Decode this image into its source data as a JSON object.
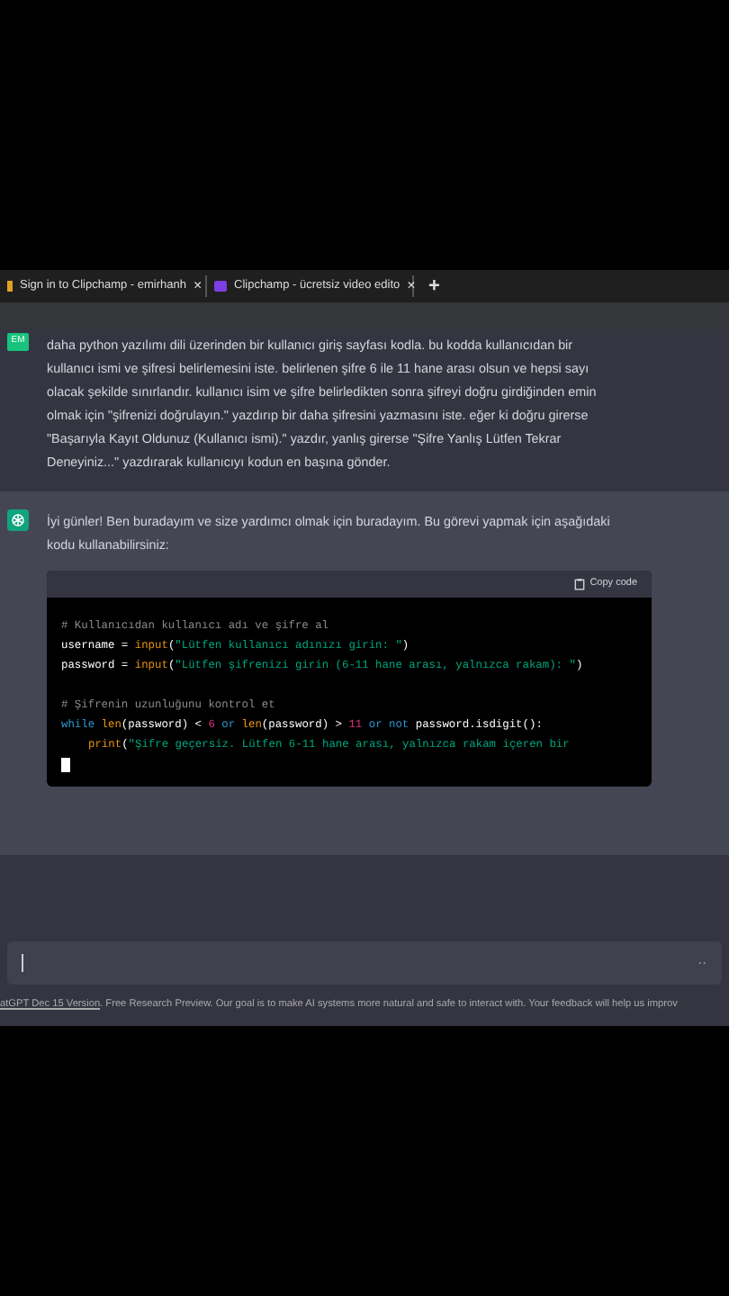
{
  "browser_tabs": [
    {
      "title": "Sign in to Clipchamp - emirhanh",
      "close": "×"
    },
    {
      "title": "Clipchamp - ücretsiz video edito",
      "close": "×"
    }
  ],
  "new_tab": "+",
  "messages": [
    {
      "kind": "user",
      "avatar": "EM",
      "paragraphs": [
        "daha python yazılımı dili üzerinden bir kullanıcı giriş sayfası kodla. bu kodda kullanıcıdan bir kullanıcı ismi ve şifresi belirlemesini iste. belirlenen şifre 6 ile 11 hane arası olsun ve hepsi sayı olacak şekilde sınırlandır. kullanıcı isim ve şifre belirledikten sonra şifreyi doğru girdiğinden emin olmak için \"şifrenizi doğrulayın.\" yazdırıp bir daha şifresini yazmasını iste. eğer ki doğru girerse \"Başarıyla Kayıt Oldunuz (Kullanıcı ismi).\" yazdır, yanlış girerse \"Şifre Yanlış Lütfen Tekrar Deneyiniz...\" yazdırarak kullanıcıyı kodun en başına gönder."
      ]
    },
    {
      "kind": "assistant",
      "paragraphs": [
        "İyi günler! Ben buradayım ve size yardımcı olmak için buradayım. Bu görevi yapmak için aşağıdaki kodu kullanabilirsiniz:"
      ],
      "code": {
        "copy_label": "Copy code",
        "lines": [
          [
            {
              "kind": "comment",
              "text": "# Kullanıcıdan kullanıcı adı ve şifre al"
            }
          ],
          [
            {
              "kind": "plain",
              "text": "username = "
            },
            {
              "kind": "func",
              "text": "input"
            },
            {
              "kind": "plain",
              "text": "("
            },
            {
              "kind": "string",
              "text": "\"Lütfen kullanıcı adınızı girin: \""
            },
            {
              "kind": "plain",
              "text": ")"
            }
          ],
          [
            {
              "kind": "plain",
              "text": "password = "
            },
            {
              "kind": "func",
              "text": "input"
            },
            {
              "kind": "plain",
              "text": "("
            },
            {
              "kind": "string",
              "text": "\"Lütfen şifrenizi girin (6-11 hane arası, yalnızca rakam): \""
            },
            {
              "kind": "plain",
              "text": ")"
            }
          ],
          {
            "kind": "blank"
          },
          [
            {
              "kind": "comment",
              "text": "# Şifrenin uzunluğunu kontrol et"
            }
          ],
          [
            {
              "kind": "keyword",
              "text": "while "
            },
            {
              "kind": "func",
              "text": "len"
            },
            {
              "kind": "plain",
              "text": "(password) < "
            },
            {
              "kind": "number",
              "text": "6"
            },
            {
              "kind": "keyword",
              "text": " or "
            },
            {
              "kind": "func",
              "text": "len"
            },
            {
              "kind": "plain",
              "text": "(password) > "
            },
            {
              "kind": "number",
              "text": "11"
            },
            {
              "kind": "keyword",
              "text": " or not "
            },
            {
              "kind": "plain",
              "text": "password.isdigit():"
            }
          ],
          {
            "kind": "indented",
            "segments": [
              {
                "kind": "func",
                "text": "print"
              },
              {
                "kind": "plain",
                "text": "("
              },
              {
                "kind": "string",
                "text": "\"Şifre geçersiz. Lütfen 6-11 hane arası, yalnızca rakam içeren bir"
              }
            ]
          }
        ]
      }
    }
  ],
  "footer": {
    "link": "atGPT Dec 15 Version",
    "text": ". Free Research Preview. Our goal is to make AI systems more natural and safe to interact with. Your feedback will help us improv"
  }
}
